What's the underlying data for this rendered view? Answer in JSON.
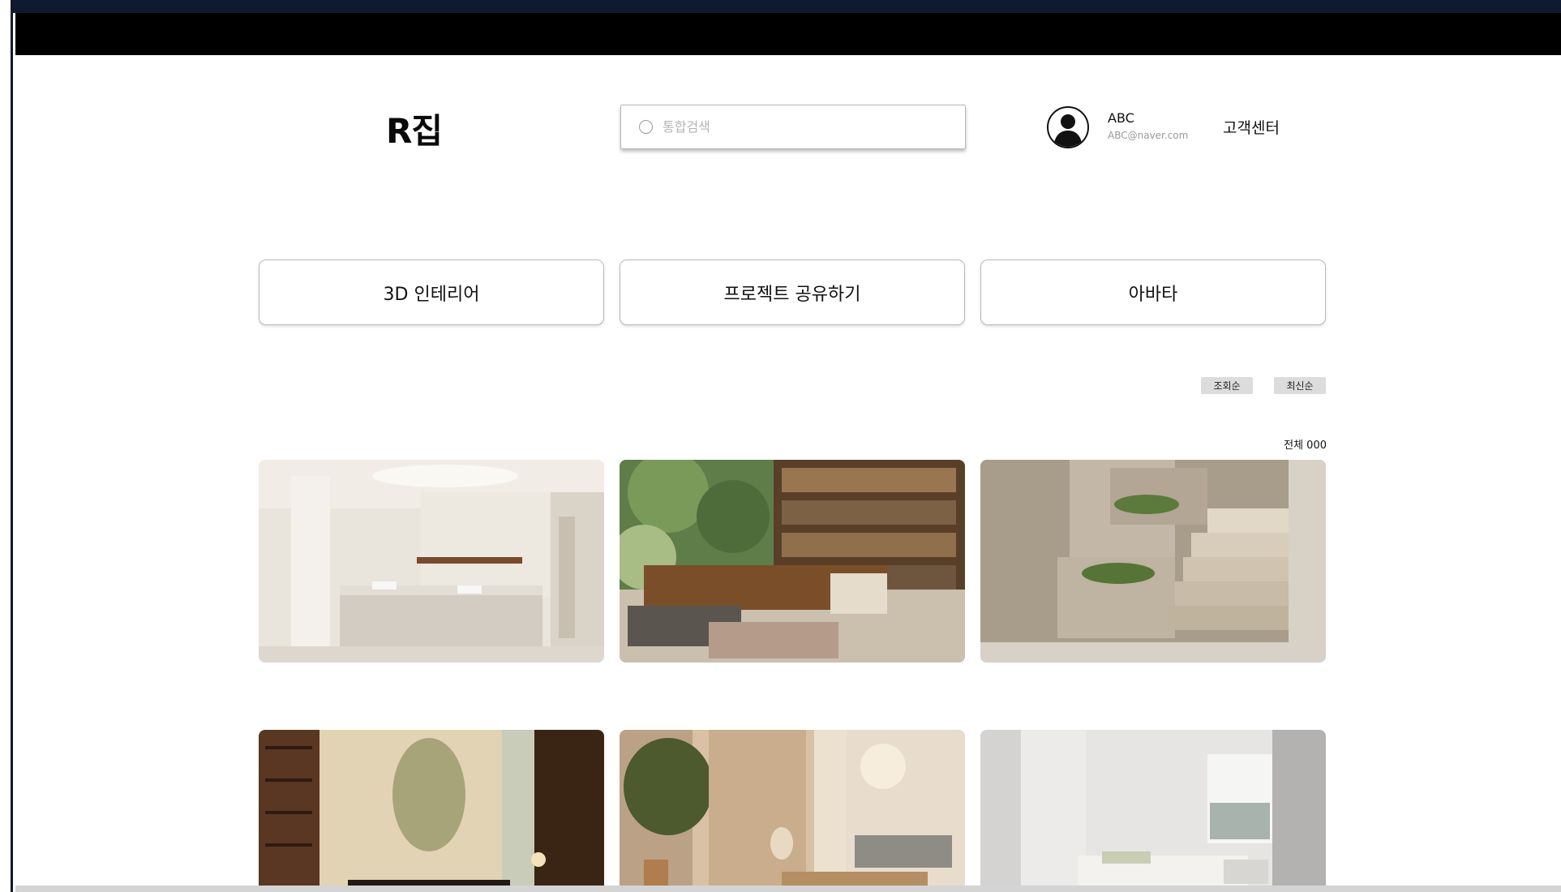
{
  "header": {
    "logo": "R집",
    "search": {
      "placeholder": "통합검색",
      "value": ""
    },
    "user": {
      "name": "ABC",
      "email": "ABC@naver.com"
    },
    "support_label": "고객센터"
  },
  "categories": [
    {
      "label": "3D 인테리어"
    },
    {
      "label": "프로젝트 공유하기"
    },
    {
      "label": "아바타"
    }
  ],
  "sort": {
    "by_views": "조회순",
    "by_recent": "최신순"
  },
  "total_label": "전체 000",
  "icons": [
    "search-icon",
    "avatar-icon"
  ],
  "colors": {
    "topbar": "#000000",
    "frame": "#0f1a30",
    "button_border": "#b9b9b9",
    "sort_bg": "#dcdcdc"
  }
}
